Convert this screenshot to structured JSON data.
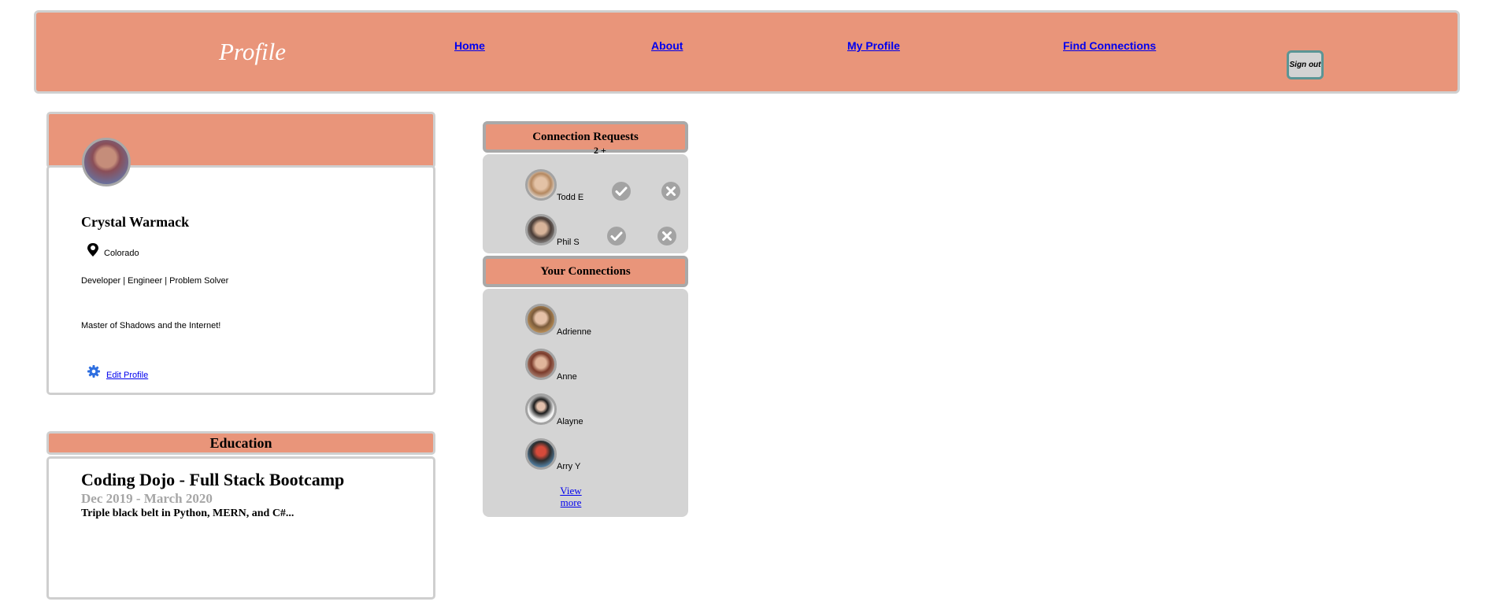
{
  "header": {
    "brand": "Profile",
    "nav": [
      "Home",
      "About",
      "My Profile",
      "Find Connections"
    ],
    "signout_label": "Sign out"
  },
  "profile": {
    "name": "Crystal Warmack",
    "location": "Colorado",
    "tagline": "Developer | Engineer | Problem Solver",
    "bio": "Master of Shadows and the Internet!",
    "edit_label": "Edit Profile"
  },
  "education": {
    "heading": "Education",
    "title": "Coding Dojo - Full Stack Bootcamp",
    "dates": "Dec 2019 - March 2020",
    "description": "Triple black belt in Python, MERN, and C#..."
  },
  "requests": {
    "heading": "Connection Requests",
    "count": "2 +",
    "items": [
      {
        "name": "Todd E"
      },
      {
        "name": "Phil S"
      }
    ]
  },
  "connections": {
    "heading": "Your Connections",
    "items": [
      {
        "name": "Adrienne"
      },
      {
        "name": "Anne"
      },
      {
        "name": "Alayne"
      },
      {
        "name": "Arry Y"
      }
    ],
    "view_more": "View more"
  },
  "colors": {
    "accent": "#e9957a",
    "panel_gray": "#d4d4d4",
    "link": "#0000ee"
  }
}
